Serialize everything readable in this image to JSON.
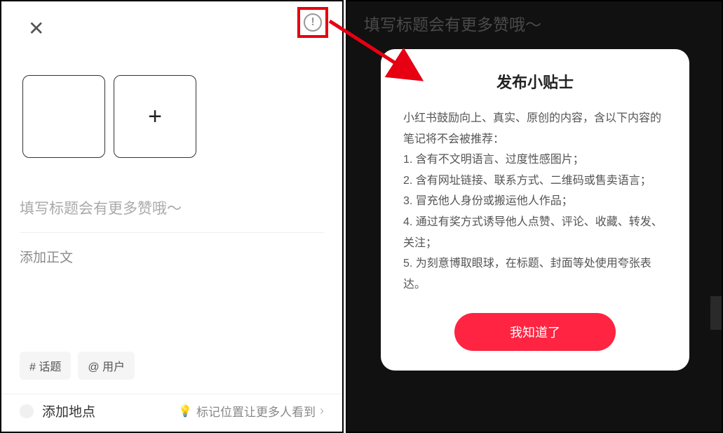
{
  "editor": {
    "title_placeholder": "填写标题会有更多赞哦～",
    "body_placeholder": "添加正文",
    "tags": {
      "topic": "# 话题",
      "user": "@ 用户"
    },
    "location": {
      "add_label": "添加地点",
      "hint": "标记位置让更多人看到"
    }
  },
  "background": {
    "title_placeholder": "填写标题会有更多赞哦～"
  },
  "modal": {
    "title": "发布小贴士",
    "intro": "小红书鼓励向上、真实、原创的内容，含以下内容的笔记将不会被推荐：",
    "rules": [
      "1. 含有不文明语言、过度性感图片；",
      "2. 含有网址链接、联系方式、二维码或售卖语言；",
      "3. 冒充他人身份或搬运他人作品；",
      "4. 通过有奖方式诱导他人点赞、评论、收藏、转发、关注；",
      "5. 为刻意博取眼球，在标题、封面等处使用夸张表达。"
    ],
    "ok": "我知道了"
  },
  "colors": {
    "accent": "#ff2442",
    "annotation": "#e60012"
  }
}
